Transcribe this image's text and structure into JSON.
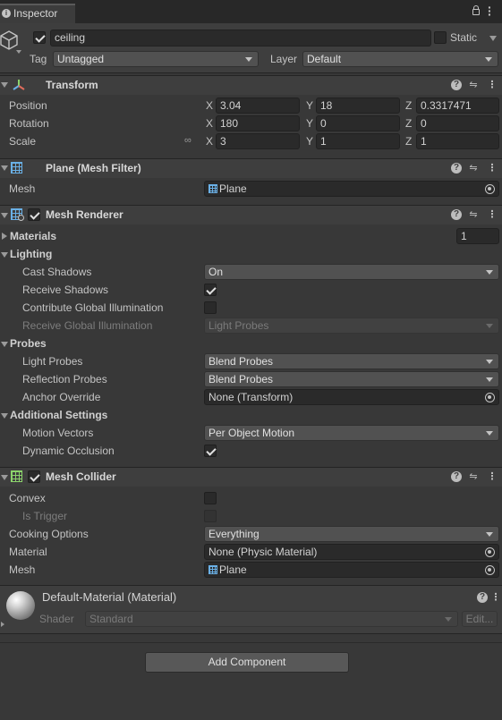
{
  "tab": {
    "title": "Inspector"
  },
  "object": {
    "name": "ceiling",
    "static_label": "Static",
    "tag_label": "Tag",
    "tag_value": "Untagged",
    "layer_label": "Layer",
    "layer_value": "Default"
  },
  "transform": {
    "title": "Transform",
    "position": {
      "label": "Position",
      "x": "3.04",
      "y": "18",
      "z": "0.3317471"
    },
    "rotation": {
      "label": "Rotation",
      "x": "180",
      "y": "0",
      "z": "0"
    },
    "scale": {
      "label": "Scale",
      "x": "3",
      "y": "1",
      "z": "1"
    },
    "axes": {
      "x": "X",
      "y": "Y",
      "z": "Z"
    }
  },
  "mesh_filter": {
    "title": "Plane (Mesh Filter)",
    "mesh_label": "Mesh",
    "mesh_value": "Plane"
  },
  "mesh_renderer": {
    "title": "Mesh Renderer",
    "materials_label": "Materials",
    "materials_count": "1",
    "lighting_label": "Lighting",
    "cast_shadows_label": "Cast Shadows",
    "cast_shadows_value": "On",
    "receive_shadows_label": "Receive Shadows",
    "contribute_gi_label": "Contribute Global Illumination",
    "receive_gi_label": "Receive Global Illumination",
    "receive_gi_value": "Light Probes",
    "probes_label": "Probes",
    "light_probes_label": "Light Probes",
    "light_probes_value": "Blend Probes",
    "reflection_probes_label": "Reflection Probes",
    "reflection_probes_value": "Blend Probes",
    "anchor_override_label": "Anchor Override",
    "anchor_override_value": "None (Transform)",
    "additional_label": "Additional Settings",
    "motion_vectors_label": "Motion Vectors",
    "motion_vectors_value": "Per Object Motion",
    "dynamic_occlusion_label": "Dynamic Occlusion"
  },
  "mesh_collider": {
    "title": "Mesh Collider",
    "convex_label": "Convex",
    "is_trigger_label": "Is Trigger",
    "cooking_label": "Cooking Options",
    "cooking_value": "Everything",
    "material_label": "Material",
    "material_value": "None (Physic Material)",
    "mesh_label": "Mesh",
    "mesh_value": "Plane"
  },
  "material": {
    "title": "Default-Material (Material)",
    "shader_label": "Shader",
    "shader_value": "Standard",
    "edit_label": "Edit..."
  },
  "add_component": {
    "label": "Add Component"
  },
  "icons": {
    "transform": "axis-gizmo-icon",
    "mesh_filter": "mesh-grid-icon",
    "renderer": "renderer-icon",
    "collider": "collider-grid-icon",
    "help": "help-icon",
    "presets": "sliders-icon",
    "more": "kebab-menu-icon",
    "lock": "lock-icon",
    "target": "object-picker-icon",
    "link": "constrain-proportions-icon"
  }
}
